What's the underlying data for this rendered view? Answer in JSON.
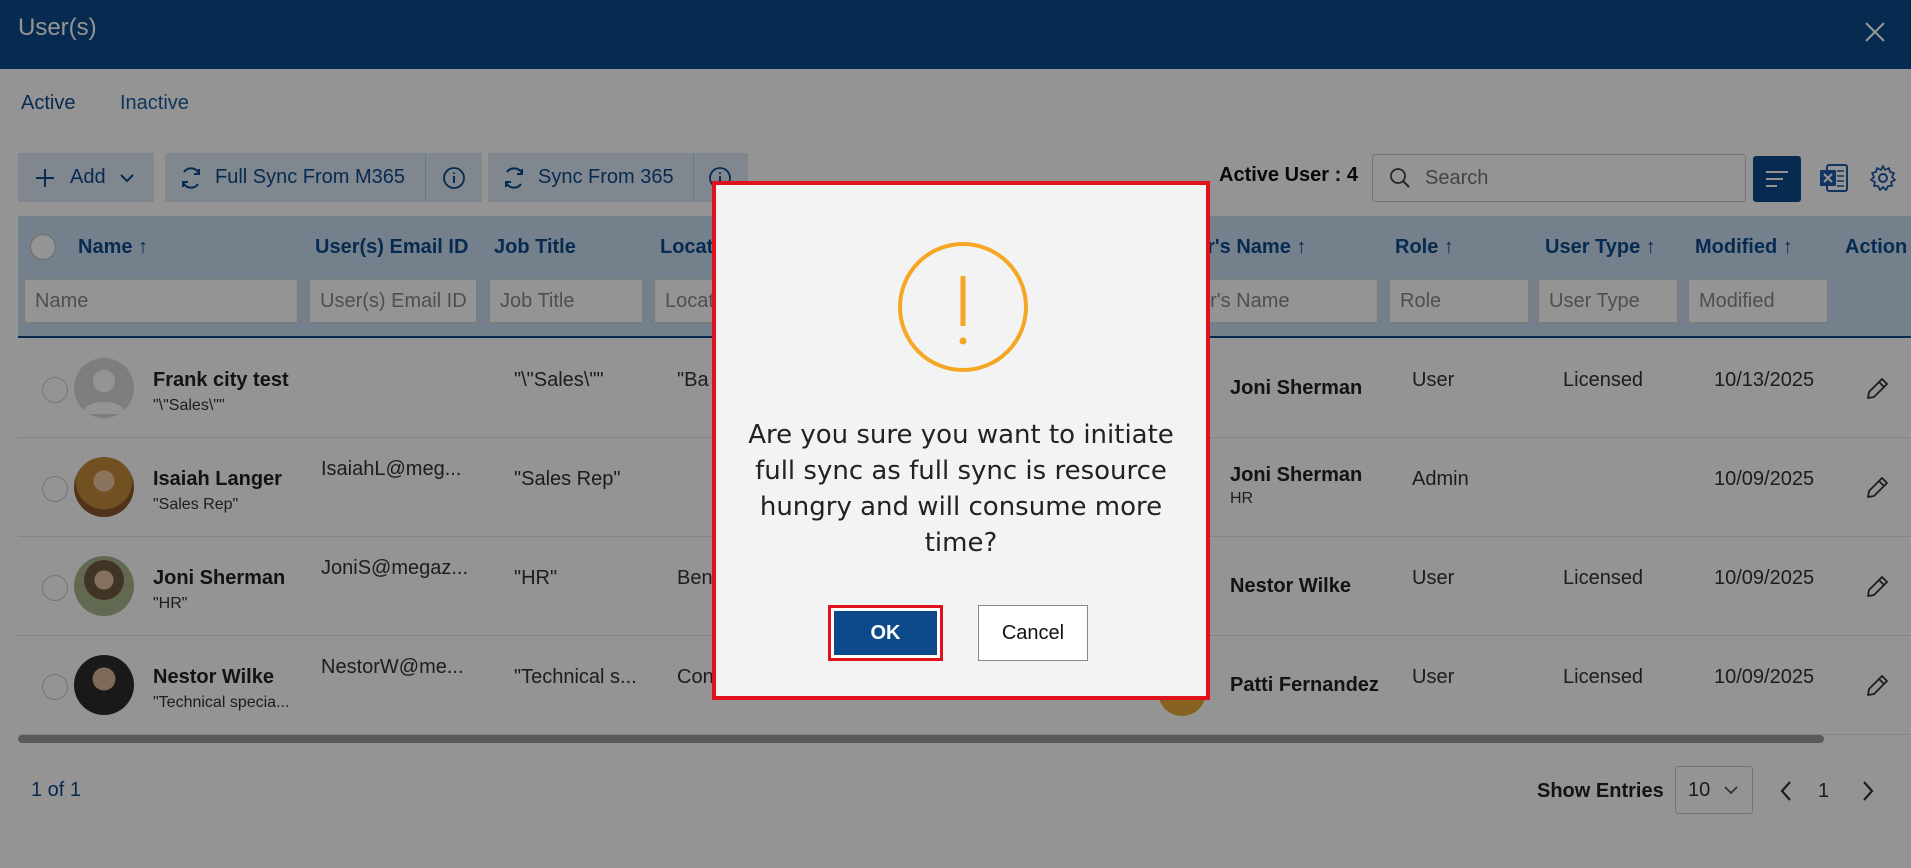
{
  "window": {
    "title": "User(s)"
  },
  "tabs": [
    {
      "label": "Active"
    },
    {
      "label": "Inactive"
    }
  ],
  "toolbar": {
    "add_label": "Add",
    "full_sync_label": "Full Sync From M365",
    "sync_label": "Sync From 365",
    "active_user_label": "Active User : 4",
    "search_placeholder": "Search"
  },
  "table": {
    "columns": [
      {
        "label": "Name ↑",
        "filter": "Name"
      },
      {
        "label": "User(s) Email ID",
        "filter": "User(s) Email ID"
      },
      {
        "label": "Job Title",
        "filter": "Job Title"
      },
      {
        "label": "Locat",
        "filter": "Locat"
      },
      {
        "label": "er's Name ↑",
        "filter": "er's Name"
      },
      {
        "label": "Role ↑",
        "filter": "Role"
      },
      {
        "label": "User Type ↑",
        "filter": "User Type"
      },
      {
        "label": "Modified ↑",
        "filter": "Modified"
      },
      {
        "label": "Action",
        "filter": ""
      }
    ],
    "rows": [
      {
        "name": "Frank city test",
        "sub": "\"\\\"Sales\\\"\"",
        "email": "",
        "job": "\"\\\"Sales\\\"\"",
        "loc": "\"Ba",
        "manager": "Joni Sherman",
        "manager_sub": "",
        "role": "User",
        "type": "Licensed",
        "modified": "10/13/2025"
      },
      {
        "name": "Isaiah Langer",
        "sub": "\"Sales Rep\"",
        "email": "IsaiahL@meg...",
        "job": "\"Sales Rep\"",
        "loc": "",
        "manager": "Joni Sherman",
        "manager_sub": "HR",
        "role": "Admin",
        "type": "",
        "modified": "10/09/2025"
      },
      {
        "name": "Joni Sherman",
        "sub": "\"HR\"",
        "email": "JoniS@megaz...",
        "job": "\"HR\"",
        "loc": "Ben",
        "manager": "Nestor Wilke",
        "manager_sub": "",
        "role": "User",
        "type": "Licensed",
        "modified": "10/09/2025"
      },
      {
        "name": "Nestor Wilke",
        "sub": "\"Technical specia...",
        "email": "NestorW@me...",
        "job": "\"Technical s...",
        "loc": "Con",
        "manager": "Patti Fernandez",
        "manager_sub": "",
        "role": "User",
        "type": "Licensed",
        "modified": "10/09/2025"
      }
    ]
  },
  "pager": {
    "summary": "1 of 1",
    "show_entries_label": "Show Entries",
    "entries_value": "10",
    "current_page": "1"
  },
  "dialog": {
    "message": "Are you sure you want to initiate full sync as full sync is resource hungry and will consume more time?",
    "ok_label": "OK",
    "cancel_label": "Cancel"
  },
  "colors": {
    "brand": "#0d4a8a",
    "warning": "#f5a623",
    "highlight": "#e0131c"
  }
}
